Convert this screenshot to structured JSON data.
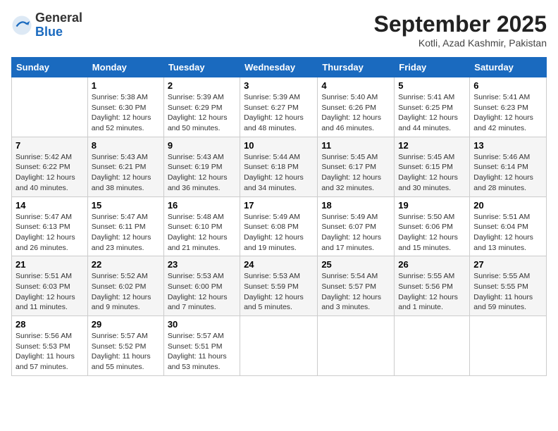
{
  "header": {
    "logo_general": "General",
    "logo_blue": "Blue",
    "month_title": "September 2025",
    "location": "Kotli, Azad Kashmir, Pakistan"
  },
  "days_of_week": [
    "Sunday",
    "Monday",
    "Tuesday",
    "Wednesday",
    "Thursday",
    "Friday",
    "Saturday"
  ],
  "weeks": [
    [
      {
        "day": "",
        "info": ""
      },
      {
        "day": "1",
        "info": "Sunrise: 5:38 AM\nSunset: 6:30 PM\nDaylight: 12 hours\nand 52 minutes."
      },
      {
        "day": "2",
        "info": "Sunrise: 5:39 AM\nSunset: 6:29 PM\nDaylight: 12 hours\nand 50 minutes."
      },
      {
        "day": "3",
        "info": "Sunrise: 5:39 AM\nSunset: 6:27 PM\nDaylight: 12 hours\nand 48 minutes."
      },
      {
        "day": "4",
        "info": "Sunrise: 5:40 AM\nSunset: 6:26 PM\nDaylight: 12 hours\nand 46 minutes."
      },
      {
        "day": "5",
        "info": "Sunrise: 5:41 AM\nSunset: 6:25 PM\nDaylight: 12 hours\nand 44 minutes."
      },
      {
        "day": "6",
        "info": "Sunrise: 5:41 AM\nSunset: 6:23 PM\nDaylight: 12 hours\nand 42 minutes."
      }
    ],
    [
      {
        "day": "7",
        "info": "Sunrise: 5:42 AM\nSunset: 6:22 PM\nDaylight: 12 hours\nand 40 minutes."
      },
      {
        "day": "8",
        "info": "Sunrise: 5:43 AM\nSunset: 6:21 PM\nDaylight: 12 hours\nand 38 minutes."
      },
      {
        "day": "9",
        "info": "Sunrise: 5:43 AM\nSunset: 6:19 PM\nDaylight: 12 hours\nand 36 minutes."
      },
      {
        "day": "10",
        "info": "Sunrise: 5:44 AM\nSunset: 6:18 PM\nDaylight: 12 hours\nand 34 minutes."
      },
      {
        "day": "11",
        "info": "Sunrise: 5:45 AM\nSunset: 6:17 PM\nDaylight: 12 hours\nand 32 minutes."
      },
      {
        "day": "12",
        "info": "Sunrise: 5:45 AM\nSunset: 6:15 PM\nDaylight: 12 hours\nand 30 minutes."
      },
      {
        "day": "13",
        "info": "Sunrise: 5:46 AM\nSunset: 6:14 PM\nDaylight: 12 hours\nand 28 minutes."
      }
    ],
    [
      {
        "day": "14",
        "info": "Sunrise: 5:47 AM\nSunset: 6:13 PM\nDaylight: 12 hours\nand 26 minutes."
      },
      {
        "day": "15",
        "info": "Sunrise: 5:47 AM\nSunset: 6:11 PM\nDaylight: 12 hours\nand 23 minutes."
      },
      {
        "day": "16",
        "info": "Sunrise: 5:48 AM\nSunset: 6:10 PM\nDaylight: 12 hours\nand 21 minutes."
      },
      {
        "day": "17",
        "info": "Sunrise: 5:49 AM\nSunset: 6:08 PM\nDaylight: 12 hours\nand 19 minutes."
      },
      {
        "day": "18",
        "info": "Sunrise: 5:49 AM\nSunset: 6:07 PM\nDaylight: 12 hours\nand 17 minutes."
      },
      {
        "day": "19",
        "info": "Sunrise: 5:50 AM\nSunset: 6:06 PM\nDaylight: 12 hours\nand 15 minutes."
      },
      {
        "day": "20",
        "info": "Sunrise: 5:51 AM\nSunset: 6:04 PM\nDaylight: 12 hours\nand 13 minutes."
      }
    ],
    [
      {
        "day": "21",
        "info": "Sunrise: 5:51 AM\nSunset: 6:03 PM\nDaylight: 12 hours\nand 11 minutes."
      },
      {
        "day": "22",
        "info": "Sunrise: 5:52 AM\nSunset: 6:02 PM\nDaylight: 12 hours\nand 9 minutes."
      },
      {
        "day": "23",
        "info": "Sunrise: 5:53 AM\nSunset: 6:00 PM\nDaylight: 12 hours\nand 7 minutes."
      },
      {
        "day": "24",
        "info": "Sunrise: 5:53 AM\nSunset: 5:59 PM\nDaylight: 12 hours\nand 5 minutes."
      },
      {
        "day": "25",
        "info": "Sunrise: 5:54 AM\nSunset: 5:57 PM\nDaylight: 12 hours\nand 3 minutes."
      },
      {
        "day": "26",
        "info": "Sunrise: 5:55 AM\nSunset: 5:56 PM\nDaylight: 12 hours\nand 1 minute."
      },
      {
        "day": "27",
        "info": "Sunrise: 5:55 AM\nSunset: 5:55 PM\nDaylight: 11 hours\nand 59 minutes."
      }
    ],
    [
      {
        "day": "28",
        "info": "Sunrise: 5:56 AM\nSunset: 5:53 PM\nDaylight: 11 hours\nand 57 minutes."
      },
      {
        "day": "29",
        "info": "Sunrise: 5:57 AM\nSunset: 5:52 PM\nDaylight: 11 hours\nand 55 minutes."
      },
      {
        "day": "30",
        "info": "Sunrise: 5:57 AM\nSunset: 5:51 PM\nDaylight: 11 hours\nand 53 minutes."
      },
      {
        "day": "",
        "info": ""
      },
      {
        "day": "",
        "info": ""
      },
      {
        "day": "",
        "info": ""
      },
      {
        "day": "",
        "info": ""
      }
    ]
  ]
}
